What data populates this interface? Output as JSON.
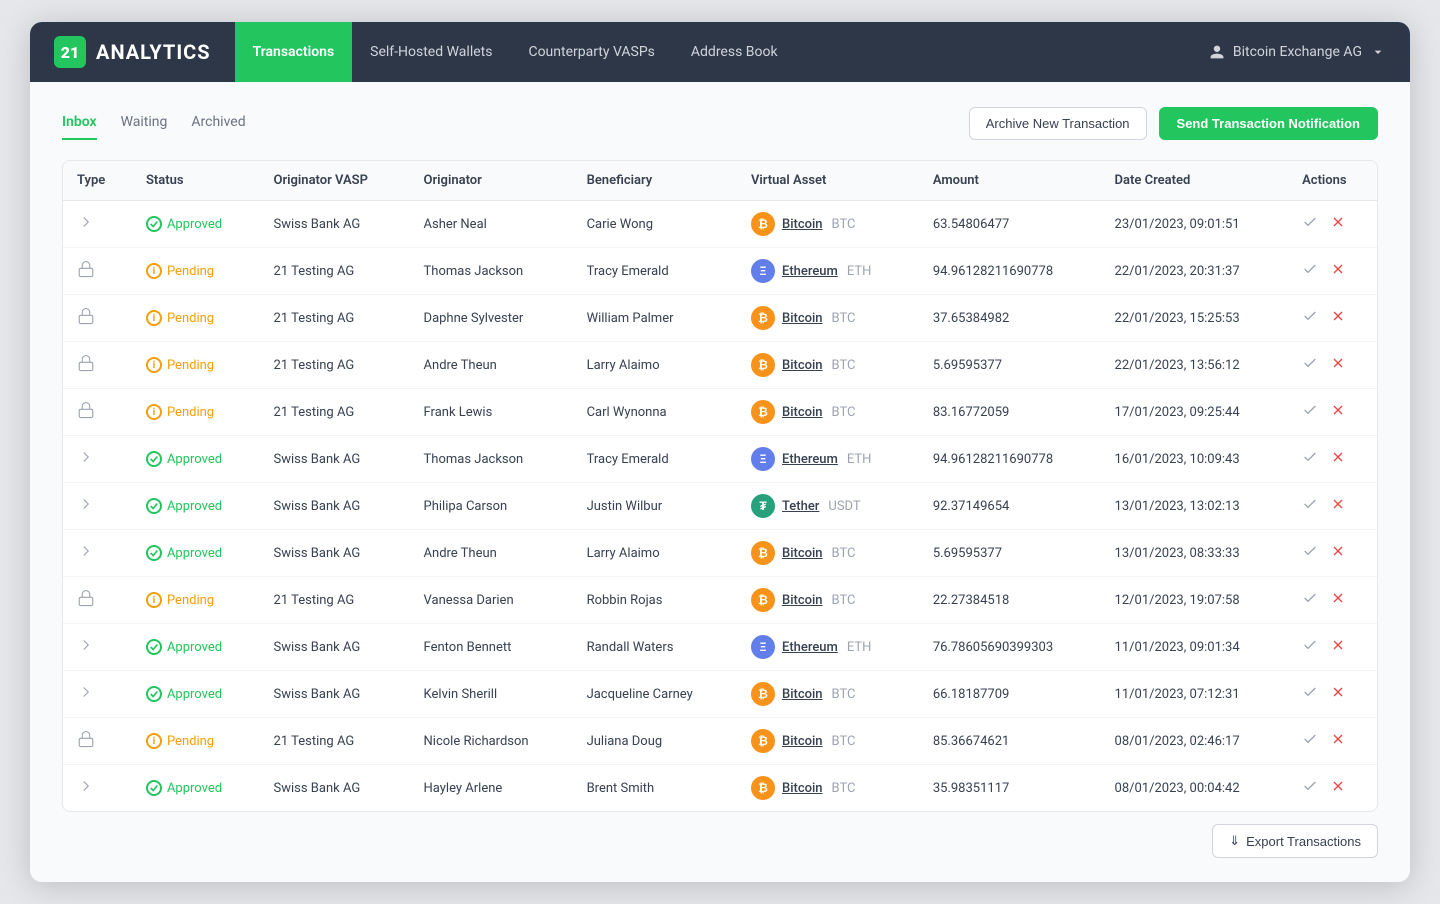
{
  "app": {
    "logo_number": "21",
    "logo_name": "ANALYTICS"
  },
  "navbar": {
    "items": [
      {
        "label": "Transactions",
        "active": true
      },
      {
        "label": "Self-Hosted Wallets",
        "active": false
      },
      {
        "label": "Counterparty VASPs",
        "active": false
      },
      {
        "label": "Address Book",
        "active": false
      }
    ],
    "user_label": "Bitcoin Exchange AG"
  },
  "tabs": [
    {
      "label": "Inbox",
      "active": true
    },
    {
      "label": "Waiting",
      "active": false
    },
    {
      "label": "Archived",
      "active": false
    }
  ],
  "buttons": {
    "archive": "Archive New Transaction",
    "send": "Send Transaction Notification",
    "export": "Export Transactions"
  },
  "table": {
    "columns": [
      "Type",
      "Status",
      "Originator VASP",
      "Originator",
      "Beneficiary",
      "Virtual Asset",
      "Amount",
      "Date Created",
      "Actions"
    ],
    "rows": [
      {
        "type": "send",
        "status": "Approved",
        "originator_vasp": "Swiss Bank AG",
        "originator": "Asher Neal",
        "beneficiary": "Carie Wong",
        "asset": "Bitcoin",
        "asset_sym": "BTC",
        "asset_type": "btc",
        "amount": "63.54806477",
        "date": "23/01/2023, 09:01:51"
      },
      {
        "type": "lock",
        "status": "Pending",
        "originator_vasp": "21 Testing AG",
        "originator": "Thomas Jackson",
        "beneficiary": "Tracy Emerald",
        "asset": "Ethereum",
        "asset_sym": "ETH",
        "asset_type": "eth",
        "amount": "94.96128211690778",
        "date": "22/01/2023, 20:31:37"
      },
      {
        "type": "lock",
        "status": "Pending",
        "originator_vasp": "21 Testing AG",
        "originator": "Daphne Sylvester",
        "beneficiary": "William Palmer",
        "asset": "Bitcoin",
        "asset_sym": "BTC",
        "asset_type": "btc",
        "amount": "37.65384982",
        "date": "22/01/2023, 15:25:53"
      },
      {
        "type": "lock",
        "status": "Pending",
        "originator_vasp": "21 Testing AG",
        "originator": "Andre Theun",
        "beneficiary": "Larry Alaimo",
        "asset": "Bitcoin",
        "asset_sym": "BTC",
        "asset_type": "btc",
        "amount": "5.69595377",
        "date": "22/01/2023, 13:56:12"
      },
      {
        "type": "lock",
        "status": "Pending",
        "originator_vasp": "21 Testing AG",
        "originator": "Frank Lewis",
        "beneficiary": "Carl Wynonna",
        "asset": "Bitcoin",
        "asset_sym": "BTC",
        "asset_type": "btc",
        "amount": "83.16772059",
        "date": "17/01/2023, 09:25:44"
      },
      {
        "type": "send",
        "status": "Approved",
        "originator_vasp": "Swiss Bank AG",
        "originator": "Thomas Jackson",
        "beneficiary": "Tracy Emerald",
        "asset": "Ethereum",
        "asset_sym": "ETH",
        "asset_type": "eth",
        "amount": "94.96128211690778",
        "date": "16/01/2023, 10:09:43"
      },
      {
        "type": "send",
        "status": "Approved",
        "originator_vasp": "Swiss Bank AG",
        "originator": "Philipa Carson",
        "beneficiary": "Justin Wilbur",
        "asset": "Tether",
        "asset_sym": "USDT",
        "asset_type": "usdt",
        "amount": "92.37149654",
        "date": "13/01/2023, 13:02:13"
      },
      {
        "type": "send",
        "status": "Approved",
        "originator_vasp": "Swiss Bank AG",
        "originator": "Andre Theun",
        "beneficiary": "Larry Alaimo",
        "asset": "Bitcoin",
        "asset_sym": "BTC",
        "asset_type": "btc",
        "amount": "5.69595377",
        "date": "13/01/2023, 08:33:33"
      },
      {
        "type": "lock",
        "status": "Pending",
        "originator_vasp": "21 Testing AG",
        "originator": "Vanessa Darien",
        "beneficiary": "Robbin Rojas",
        "asset": "Bitcoin",
        "asset_sym": "BTC",
        "asset_type": "btc",
        "amount": "22.27384518",
        "date": "12/01/2023, 19:07:58"
      },
      {
        "type": "send",
        "status": "Approved",
        "originator_vasp": "Swiss Bank AG",
        "originator": "Fenton Bennett",
        "beneficiary": "Randall Waters",
        "asset": "Ethereum",
        "asset_sym": "ETH",
        "asset_type": "eth",
        "amount": "76.78605690399303",
        "date": "11/01/2023, 09:01:34"
      },
      {
        "type": "send",
        "status": "Approved",
        "originator_vasp": "Swiss Bank AG",
        "originator": "Kelvin Sherill",
        "beneficiary": "Jacqueline Carney",
        "asset": "Bitcoin",
        "asset_sym": "BTC",
        "asset_type": "btc",
        "amount": "66.18187709",
        "date": "11/01/2023, 07:12:31"
      },
      {
        "type": "lock",
        "status": "Pending",
        "originator_vasp": "21 Testing AG",
        "originator": "Nicole Richardson",
        "beneficiary": "Juliana Doug",
        "asset": "Bitcoin",
        "asset_sym": "BTC",
        "asset_type": "btc",
        "amount": "85.36674621",
        "date": "08/01/2023, 02:46:17"
      },
      {
        "type": "send",
        "status": "Approved",
        "originator_vasp": "Swiss Bank AG",
        "originator": "Hayley Arlene",
        "beneficiary": "Brent Smith",
        "asset": "Bitcoin",
        "asset_sym": "BTC",
        "asset_type": "btc",
        "amount": "35.98351117",
        "date": "08/01/2023, 00:04:42"
      }
    ]
  }
}
